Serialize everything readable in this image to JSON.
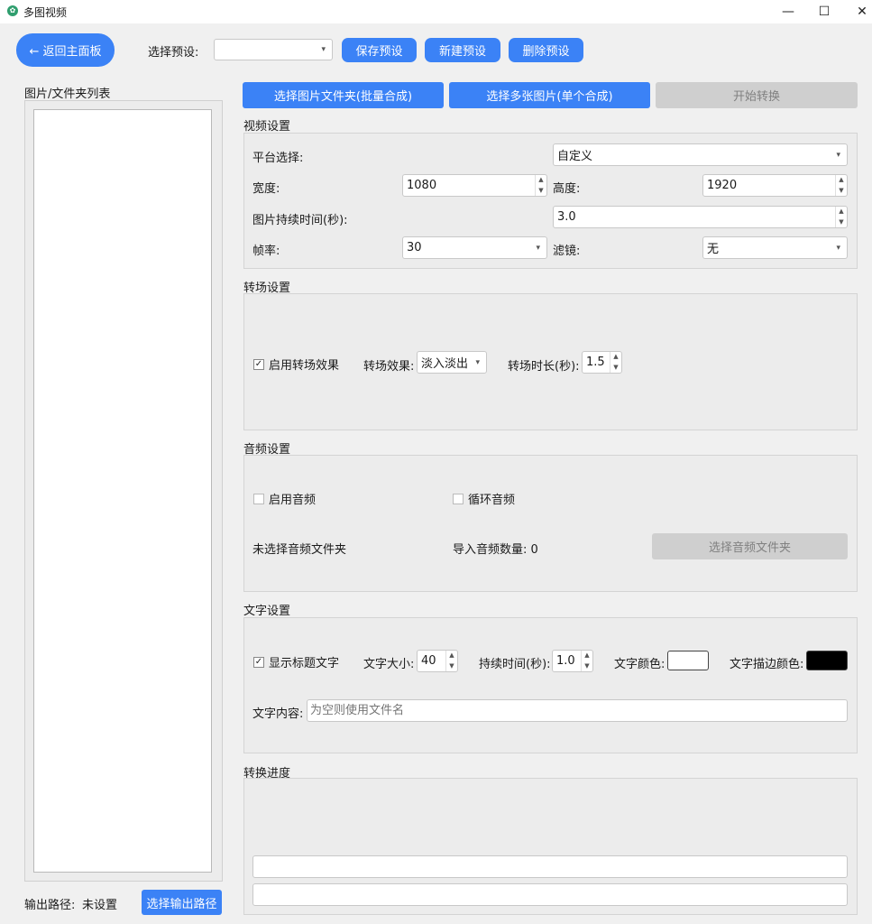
{
  "window": {
    "title": "多图视频",
    "icon": "app-logo-icon",
    "controls": {
      "minimize": "—",
      "maximize": "☐",
      "close": "✕"
    }
  },
  "toolbar": {
    "back_label": "← 返回主面板",
    "preset_label": "选择预设:",
    "preset_value": "",
    "save_preset": "保存预设",
    "new_preset": "新建预设",
    "delete_preset": "删除预设"
  },
  "left_panel": {
    "title": "图片/文件夹列表",
    "output_label": "输出路径:",
    "output_value": "未设置",
    "choose_output": "选择输出路径"
  },
  "actions": {
    "select_folder": "选择图片文件夹(批量合成)",
    "select_images": "选择多张图片(单个合成)",
    "start": "开始转换"
  },
  "video_settings": {
    "title": "视频设置",
    "platform_label": "平台选择:",
    "platform_value": "自定义",
    "width_label": "宽度:",
    "width_value": "1080",
    "height_label": "高度:",
    "height_value": "1920",
    "duration_label": "图片持续时间(秒):",
    "duration_value": "3.0",
    "fps_label": "帧率:",
    "fps_value": "30",
    "filter_label": "滤镜:",
    "filter_value": "无"
  },
  "transition_settings": {
    "title": "转场设置",
    "enable_label": "启用转场效果",
    "enable_checked": true,
    "effect_label": "转场效果:",
    "effect_value": "淡入淡出",
    "duration_label": "转场时长(秒):",
    "duration_value": "1.5"
  },
  "audio_settings": {
    "title": "音频设置",
    "enable_label": "启用音频",
    "loop_label": "循环音频",
    "folder_status": "未选择音频文件夹",
    "count_label": "导入音频数量: 0",
    "choose_folder": "选择音频文件夹"
  },
  "text_settings": {
    "title": "文字设置",
    "show_title_label": "显示标题文字",
    "show_title_checked": true,
    "size_label": "文字大小:",
    "size_value": "40",
    "duration_label": "持续时间(秒):",
    "duration_value": "1.0",
    "color_label": "文字颜色:",
    "text_color": "#ffffff",
    "stroke_label": "文字描边颜色:",
    "stroke_color": "#000000",
    "content_label": "文字内容:",
    "content_placeholder": "为空则使用文件名",
    "content_value": ""
  },
  "progress": {
    "title": "转换进度"
  },
  "colors": {
    "accent": "#3b82f6",
    "disabled": "#cfcfcf"
  }
}
